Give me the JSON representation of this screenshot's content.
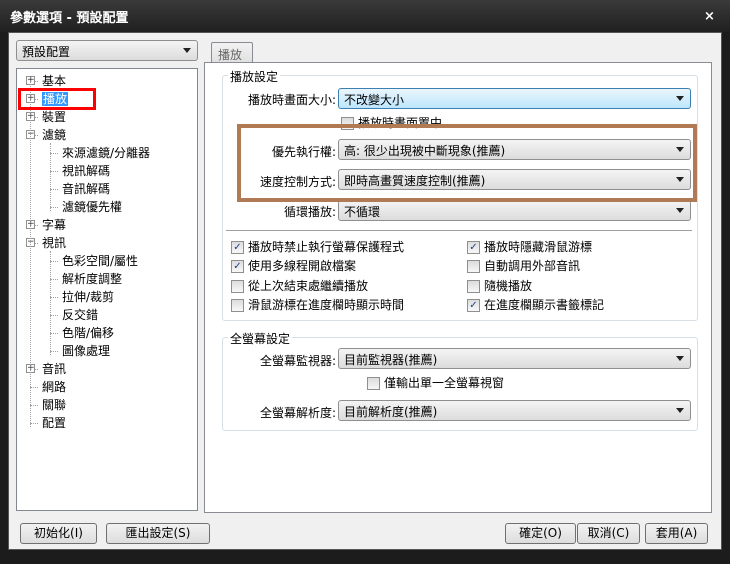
{
  "window": {
    "title": "參數選項 - 預設配置",
    "close": "×"
  },
  "profile_combo": {
    "value": "預設配置"
  },
  "tree": [
    {
      "label": "基本",
      "level": 0,
      "expander": "+"
    },
    {
      "label": "播放",
      "level": 0,
      "expander": "+",
      "selected": true
    },
    {
      "label": "裝置",
      "level": 0,
      "expander": "+"
    },
    {
      "label": "濾鏡",
      "level": 0,
      "expander": "-"
    },
    {
      "label": "來源濾鏡/分離器",
      "level": 1
    },
    {
      "label": "視訊解碼",
      "level": 1
    },
    {
      "label": "音訊解碼",
      "level": 1
    },
    {
      "label": "濾鏡優先權",
      "level": 1
    },
    {
      "label": "字幕",
      "level": 0,
      "expander": "+"
    },
    {
      "label": "視訊",
      "level": 0,
      "expander": "-"
    },
    {
      "label": "色彩空間/屬性",
      "level": 1
    },
    {
      "label": "解析度調整",
      "level": 1
    },
    {
      "label": "拉伸/裁剪",
      "level": 1
    },
    {
      "label": "反交錯",
      "level": 1
    },
    {
      "label": "色階/偏移",
      "level": 1
    },
    {
      "label": "圖像處理",
      "level": 1
    },
    {
      "label": "音訊",
      "level": 0,
      "expander": "+"
    },
    {
      "label": "網路",
      "level": 0
    },
    {
      "label": "關聯",
      "level": 0
    },
    {
      "label": "配置",
      "level": 0
    }
  ],
  "tab": {
    "label": "播放"
  },
  "playback": {
    "group_label": "播放設定",
    "size_label": "播放時畫面大小:",
    "size_value": "不改變大小",
    "center_label": "播放時畫面置中",
    "center_checked": false,
    "priority_label": "優先執行權:",
    "priority_value": "高: 很少出現被中斷現象(推薦)",
    "speed_label": "速度控制方式:",
    "speed_value": "即時高畫質速度控制(推薦)",
    "loop_label": "循環播放:",
    "loop_value": "不循環",
    "checkboxes": [
      {
        "label": "播放時禁止執行螢幕保護程式",
        "checked": true
      },
      {
        "label": "播放時隱藏滑鼠游標",
        "checked": true
      },
      {
        "label": "使用多線程開啟檔案",
        "checked": true
      },
      {
        "label": "自動調用外部音訊",
        "checked": false
      },
      {
        "label": "從上次結束處繼續播放",
        "checked": false
      },
      {
        "label": "隨機播放",
        "checked": false
      },
      {
        "label": "滑鼠游標在進度欄時顯示時間",
        "checked": false
      },
      {
        "label": "在進度欄顯示書籤標記",
        "checked": true
      }
    ]
  },
  "fullscreen": {
    "group_label": "全螢幕設定",
    "monitor_label": "全螢幕監視器:",
    "monitor_value": "目前監視器(推薦)",
    "single_label": "僅輸出單一全螢幕視窗",
    "single_checked": false,
    "res_label": "全螢幕解析度:",
    "res_value": "目前解析度(推薦)"
  },
  "buttons": {
    "init": "初始化(I)",
    "export": "匯出設定(S)",
    "ok": "確定(O)",
    "cancel": "取消(C)",
    "apply": "套用(A)"
  },
  "annotations": {
    "highlight_red": "#ff0000",
    "highlight_brown": "#b07a55"
  }
}
